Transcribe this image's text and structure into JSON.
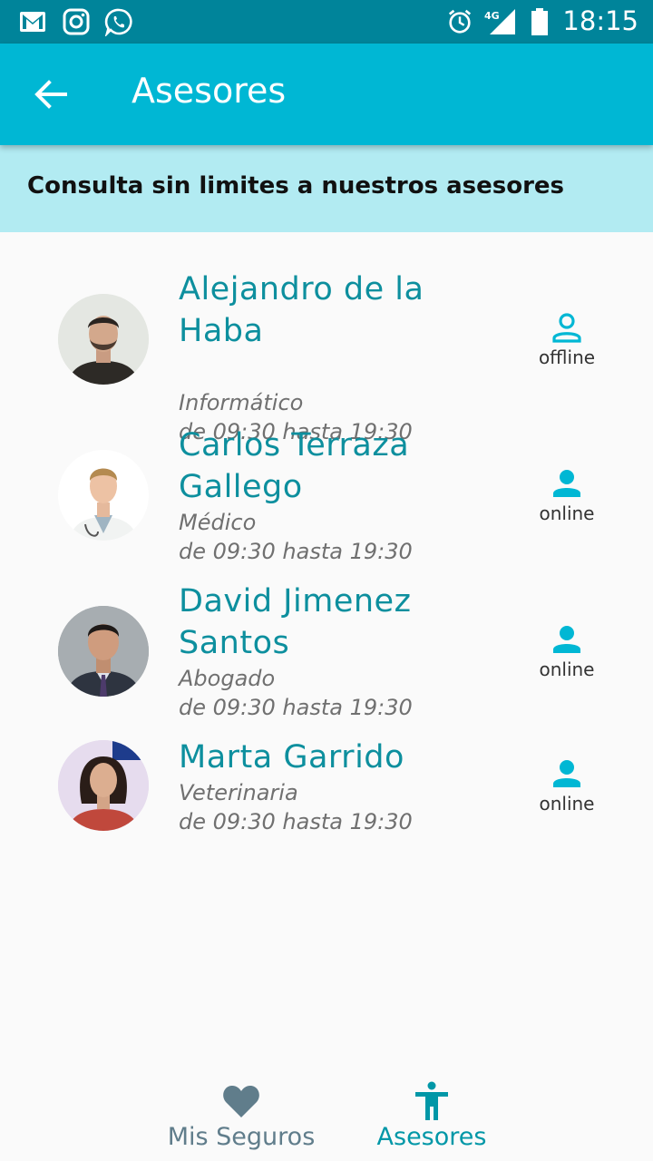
{
  "status_bar": {
    "time": "18:15",
    "network": "4G"
  },
  "app_bar": {
    "title": "Asesores"
  },
  "subheader": {
    "text": "Consulta sin limites a nuestros asesores"
  },
  "advisors": [
    {
      "name_line1": "Alejandro de la",
      "name_line2": "Haba",
      "profession": "Informático",
      "hours": "de 09:30 hasta 19:30",
      "status": "offline"
    },
    {
      "name_line1": "Carlos Terraza",
      "name_line2": "Gallego",
      "profession": "Médico",
      "hours": "de 09:30 hasta 19:30",
      "status": "online"
    },
    {
      "name_line1": "David Jimenez",
      "name_line2": "Santos",
      "profession": "Abogado",
      "hours": "de 09:30 hasta 19:30",
      "status": "online"
    },
    {
      "name_line1": "Marta Garrido",
      "name_line2": "",
      "profession": "Veterinaria",
      "hours": "de 09:30 hasta 19:30",
      "status": "online"
    }
  ],
  "bottom_nav": {
    "items": [
      {
        "label": "Mis Seguros",
        "icon": "heart-icon",
        "active": false
      },
      {
        "label": "Asesores",
        "icon": "accessibility-icon",
        "active": true
      }
    ]
  },
  "colors": {
    "status_bar": "#00849a",
    "app_bar": "#00b7d4",
    "subheader": "#b2ebf2",
    "accent": "#00b7d4",
    "name": "#0d8f9e",
    "inactive_nav": "#607d8b"
  }
}
